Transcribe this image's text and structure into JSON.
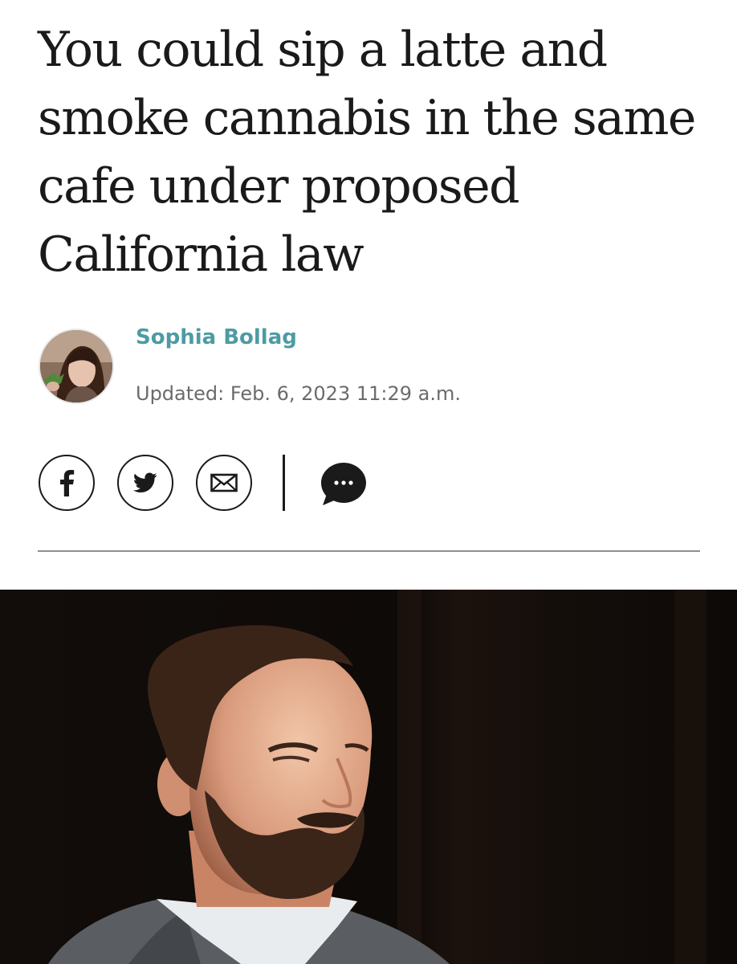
{
  "article": {
    "headline": "You could sip a latte and smoke cannabis in the same cafe under proposed California law",
    "author": {
      "name": "Sophia Bollag",
      "avatar_icon": "author-avatar-photo"
    },
    "updated": "Updated: Feb. 6, 2023 11:29 a.m."
  },
  "share": {
    "facebook_icon": "facebook-icon",
    "twitter_icon": "twitter-icon",
    "email_icon": "email-icon",
    "comment_icon": "comment-bubble-icon"
  },
  "colors": {
    "author_link": "#4d9ba4",
    "headline": "#1a1a1a",
    "meta": "#6b6b6b",
    "rule": "#8f8f8f"
  }
}
